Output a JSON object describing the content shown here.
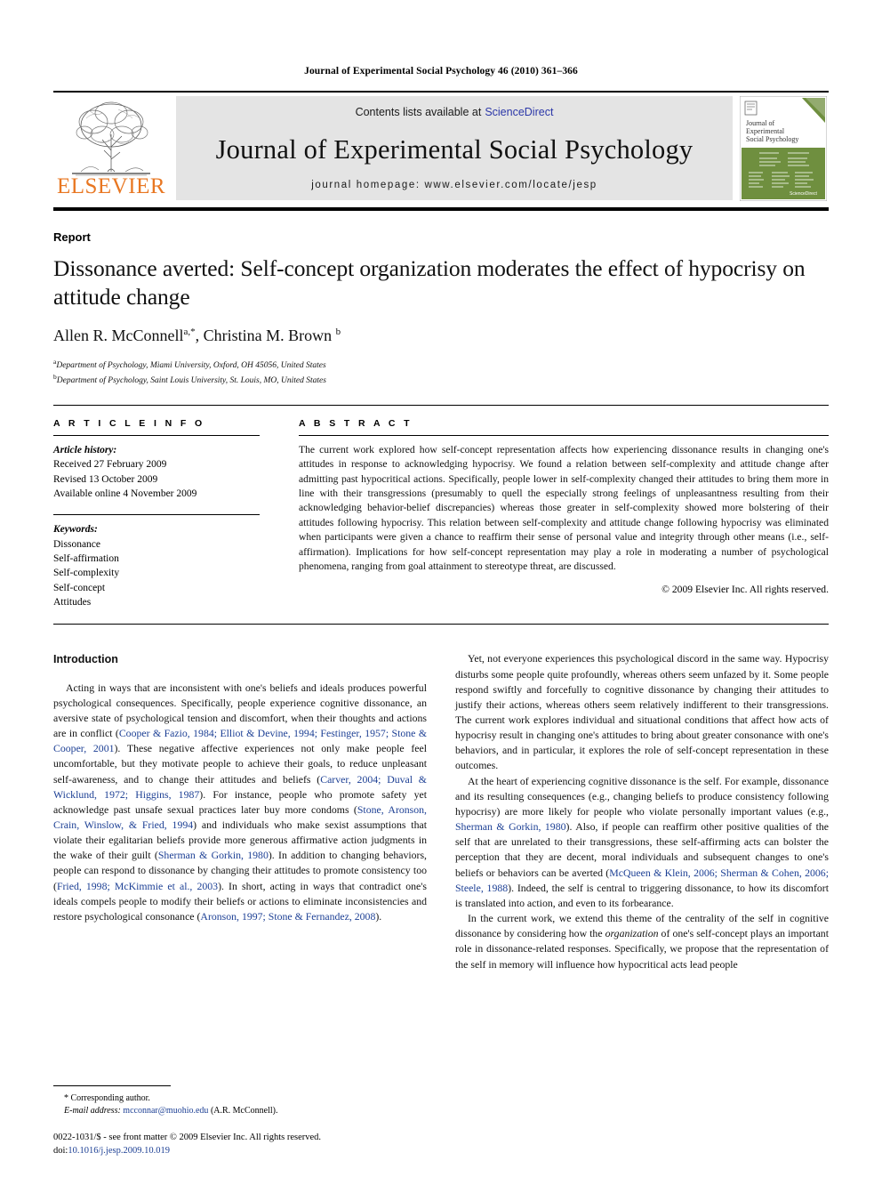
{
  "running_head": "Journal of Experimental Social Psychology 46 (2010) 361–366",
  "masthead": {
    "publisher_name": "ELSEVIER",
    "contents_text": "Contents lists available at",
    "sciencedirect_label": "ScienceDirect",
    "journal_title": "Journal of Experimental Social Psychology",
    "homepage_text": "journal homepage: www.elsevier.com/locate/jesp",
    "cover_title_line1": "Journal of",
    "cover_title_line2": "Experimental",
    "cover_title_line3": "Social Psychology",
    "cover_footer": "ScienceDirect",
    "sciencedirect_color": "#2b37a8",
    "elsevier_color": "#E87722",
    "cover_green": "#6f8f3f"
  },
  "article": {
    "type_label": "Report",
    "title": "Dissonance averted: Self-concept organization moderates the effect of hypocrisy on attitude change",
    "authors_html": "Allen R. McConnell<sup>a,*</sup>, Christina M. Brown <sup>b</sup>",
    "affiliation_a": "Department of Psychology, Miami University, Oxford, OH 45056, United States",
    "affiliation_b": "Department of Psychology, Saint Louis University, St. Louis, MO, United States"
  },
  "article_info": {
    "heading": "A R T I C L E   I N F O",
    "history_label": "Article history:",
    "history": [
      "Received 27 February 2009",
      "Revised 13 October 2009",
      "Available online 4 November 2009"
    ],
    "keywords_label": "Keywords:",
    "keywords": [
      "Dissonance",
      "Self-affirmation",
      "Self-complexity",
      "Self-concept",
      "Attitudes"
    ]
  },
  "abstract": {
    "heading": "A B S T R A C T",
    "text": "The current work explored how self-concept representation affects how experiencing dissonance results in changing one's attitudes in response to acknowledging hypocrisy. We found a relation between self-complexity and attitude change after admitting past hypocritical actions. Specifically, people lower in self-complexity changed their attitudes to bring them more in line with their transgressions (presumably to quell the especially strong feelings of unpleasantness resulting from their acknowledging behavior-belief discrepancies) whereas those greater in self-complexity showed more bolstering of their attitudes following hypocrisy. This relation between self-complexity and attitude change following hypocrisy was eliminated when participants were given a chance to reaffirm their sense of personal value and integrity through other means (i.e., self-affirmation). Implications for how self-concept representation may play a role in moderating a number of psychological phenomena, ranging from goal attainment to stereotype threat, are discussed.",
    "copyright": "© 2009 Elsevier Inc. All rights reserved."
  },
  "body": {
    "section_heading": "Introduction",
    "left_paragraphs": [
      "Acting in ways that are inconsistent with one's beliefs and ideals produces powerful psychological consequences. Specifically, people experience cognitive dissonance, an aversive state of psychological tension and discomfort, when their thoughts and actions are in conflict (<span class=\"ref\">Cooper &amp; Fazio, 1984; Elliot &amp; Devine, 1994; Festinger, 1957; Stone &amp; Cooper, 2001</span>). These negative affective experiences not only make people feel uncomfortable, but they motivate people to achieve their goals, to reduce unpleasant self-awareness, and to change their attitudes and beliefs (<span class=\"ref\">Carver, 2004; Duval &amp; Wicklund, 1972; Higgins, 1987</span>). For instance, people who promote safety yet acknowledge past unsafe sexual practices later buy more condoms (<span class=\"ref\">Stone, Aronson, Crain, Winslow, &amp; Fried, 1994</span>) and individuals who make sexist assumptions that violate their egalitarian beliefs provide more generous affirmative action judgments in the wake of their guilt (<span class=\"ref\">Sherman &amp; Gorkin, 1980</span>). In addition to changing behaviors, people can respond to dissonance by changing their attitudes to promote consistency too (<span class=\"ref\">Fried, 1998; McKimmie et al., 2003</span>). In short, acting in ways that contradict one's ideals compels people to modify their beliefs or actions to eliminate inconsistencies and restore psychological consonance (<span class=\"ref\">Aronson, 1997; Stone &amp; Fernandez, 2008</span>)."
    ],
    "right_paragraphs": [
      "Yet, not everyone experiences this psychological discord in the same way. Hypocrisy disturbs some people quite profoundly, whereas others seem unfazed by it. Some people respond swiftly and forcefully to cognitive dissonance by changing their attitudes to justify their actions, whereas others seem relatively indifferent to their transgressions. The current work explores individual and situational conditions that affect how acts of hypocrisy result in changing one's attitudes to bring about greater consonance with one's behaviors, and in particular, it explores the role of self-concept representation in these outcomes.",
      "At the heart of experiencing cognitive dissonance is the self. For example, dissonance and its resulting consequences (e.g., changing beliefs to produce consistency following hypocrisy) are more likely for people who violate personally important values (e.g., <span class=\"ref\">Sherman &amp; Gorkin, 1980</span>). Also, if people can reaffirm other positive qualities of the self that are unrelated to their transgressions, these self-affirming acts can bolster the perception that they are decent, moral individuals and subsequent changes to one's beliefs or behaviors can be averted (<span class=\"ref\">McQueen &amp; Klein, 2006; Sherman &amp; Cohen, 2006; Steele, 1988</span>). Indeed, the self is central to triggering dissonance, to how its discomfort is translated into action, and even to its forbearance.",
      "In the current work, we extend this theme of the centrality of the self in cognitive dissonance by considering how the <em class=\"it\">organization</em> of one's self-concept plays an important role in dissonance-related responses. Specifically, we propose that the representation of the self in memory will influence how hypocritical acts lead people"
    ]
  },
  "footer": {
    "corresponding_marker": "*",
    "corresponding_label": "Corresponding author.",
    "email_label": "E-mail address:",
    "email": "mcconnar@muohio.edu",
    "email_owner": "(A.R. McConnell).",
    "issn_line": "0022-1031/$ - see front matter © 2009 Elsevier Inc. All rights reserved.",
    "doi_label": "doi:",
    "doi_value": "10.1016/j.jesp.2009.10.019"
  }
}
